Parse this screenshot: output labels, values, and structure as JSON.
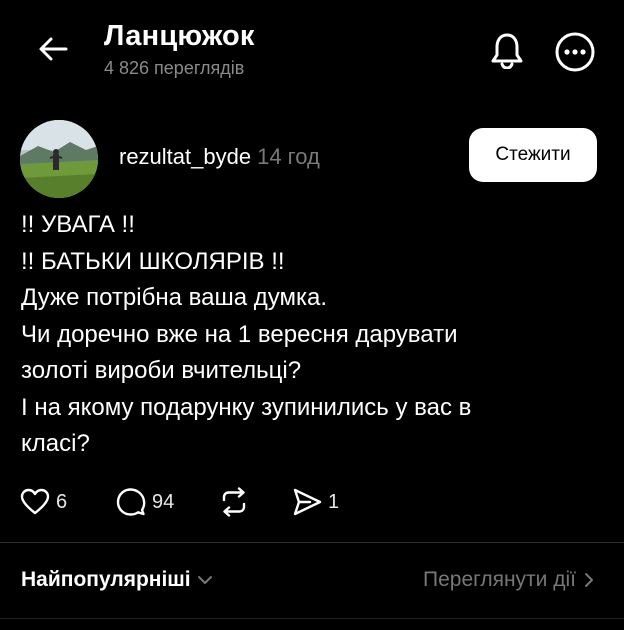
{
  "header": {
    "title": "Ланцюжок",
    "views": "4 826 переглядів"
  },
  "post": {
    "username": "rezultat_byde",
    "time": "14 год",
    "follow_label": "Стежити",
    "lines": [
      "!! УВАГА !!",
      "!! БАТЬКИ ШКОЛЯРІВ !!",
      "Дуже потрібна ваша думка.",
      "Чи доречно вже на 1 вересня дарувати",
      "золоті вироби вчительці?",
      "І на якому подарунку зупинились у вас в",
      "класі?"
    ],
    "likes": "6",
    "replies": "94",
    "shares": "1"
  },
  "sort": {
    "label": "Найпопулярніші",
    "view_activity": "Переглянути дії"
  },
  "colors": {
    "background": "#000000",
    "text": "#ffffff",
    "muted": "#7a7a7a",
    "follow_bg": "#ffffff"
  },
  "icons": [
    "back-arrow-icon",
    "bell-icon",
    "more-icon",
    "heart-icon",
    "reply-bubble-icon",
    "repost-icon",
    "share-send-icon",
    "chevron-down-icon",
    "chevron-right-icon"
  ]
}
